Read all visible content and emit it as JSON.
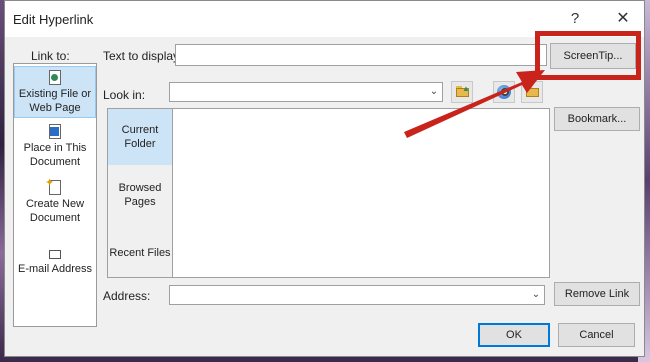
{
  "dialog": {
    "title": "Edit Hyperlink",
    "help_label": "?",
    "close_label": "✕"
  },
  "link_to": {
    "label": "Link to:",
    "items": [
      {
        "label": "Existing File or Web Page",
        "icon": "existing-file-icon",
        "selected": true
      },
      {
        "label": "Place in This Document",
        "icon": "place-in-document-icon",
        "selected": false
      },
      {
        "label": "Create New Document",
        "icon": "new-document-icon",
        "selected": false
      },
      {
        "label": "E-mail Address",
        "icon": "email-icon",
        "selected": false
      }
    ]
  },
  "text_to_display": {
    "label": "Text to display:",
    "value": ""
  },
  "screentip_button": "ScreenTip...",
  "look_in": {
    "label": "Look in:",
    "value": ""
  },
  "nav": {
    "items": [
      {
        "label": "Current Folder",
        "selected": true
      },
      {
        "label": "Browsed Pages",
        "selected": false
      },
      {
        "label": "Recent Files",
        "selected": false
      }
    ]
  },
  "bookmark_button": "Bookmark...",
  "address": {
    "label": "Address:",
    "value": ""
  },
  "remove_link_button": "Remove Link",
  "ok_button": "OK",
  "cancel_button": "Cancel",
  "colors": {
    "highlight": "#c8241b",
    "selection": "#cde4f7",
    "primary_border": "#0078d7"
  }
}
